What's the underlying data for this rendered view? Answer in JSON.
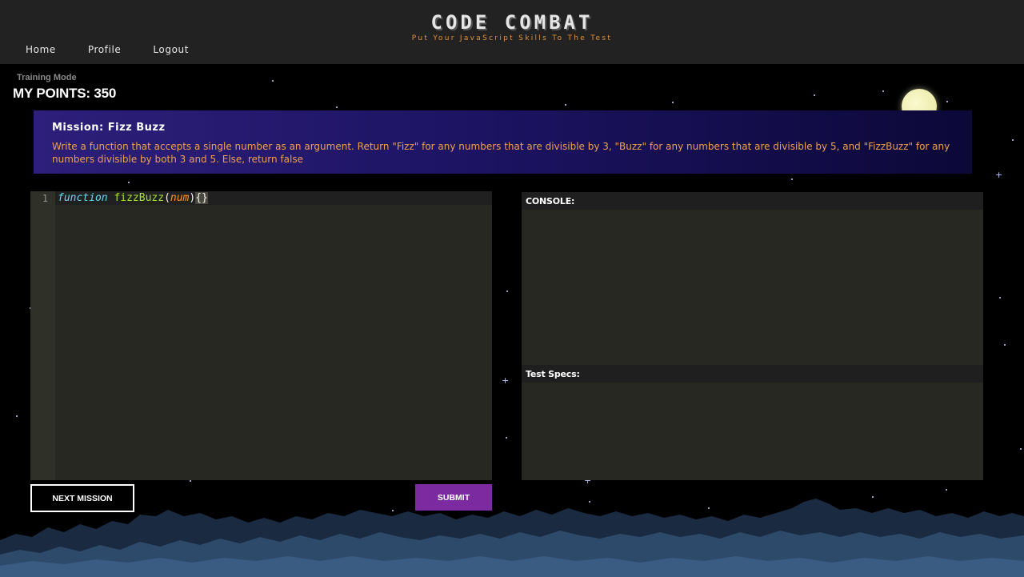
{
  "header": {
    "title": "CODE COMBAT",
    "subtitle": "Put Your JavaScript Skills To The Test",
    "nav": [
      "Home",
      "Profile",
      "Logout"
    ]
  },
  "status": {
    "mode": "Training Mode",
    "points": "MY POINTS: 350"
  },
  "mission": {
    "title": "Mission: Fizz Buzz",
    "description": "Write a function that accepts a single number as an argument. Return \"Fizz\" for any numbers that are divisible by 3, \"Buzz\" for any numbers that are divisible by 5, and \"FizzBuzz\" for any numbers divisible by both 3 and 5. Else, return false"
  },
  "editor": {
    "line_number": "1",
    "code": {
      "keyword": "function",
      "name": "fizzBuzz",
      "open_paren": "(",
      "param": "num",
      "close_paren": ")",
      "braces": "{}"
    }
  },
  "console": {
    "label": "CONSOLE:"
  },
  "test_specs": {
    "label": "Test Specs:"
  },
  "buttons": {
    "next": "NEXT MISSION",
    "submit": "SUBMIT"
  },
  "colors": {
    "header_bg": "#222222",
    "subtitle": "#e0903a",
    "mission_text": "#f0a24a",
    "submit_bg": "#7b2aa0",
    "editor_bg": "#272822"
  }
}
